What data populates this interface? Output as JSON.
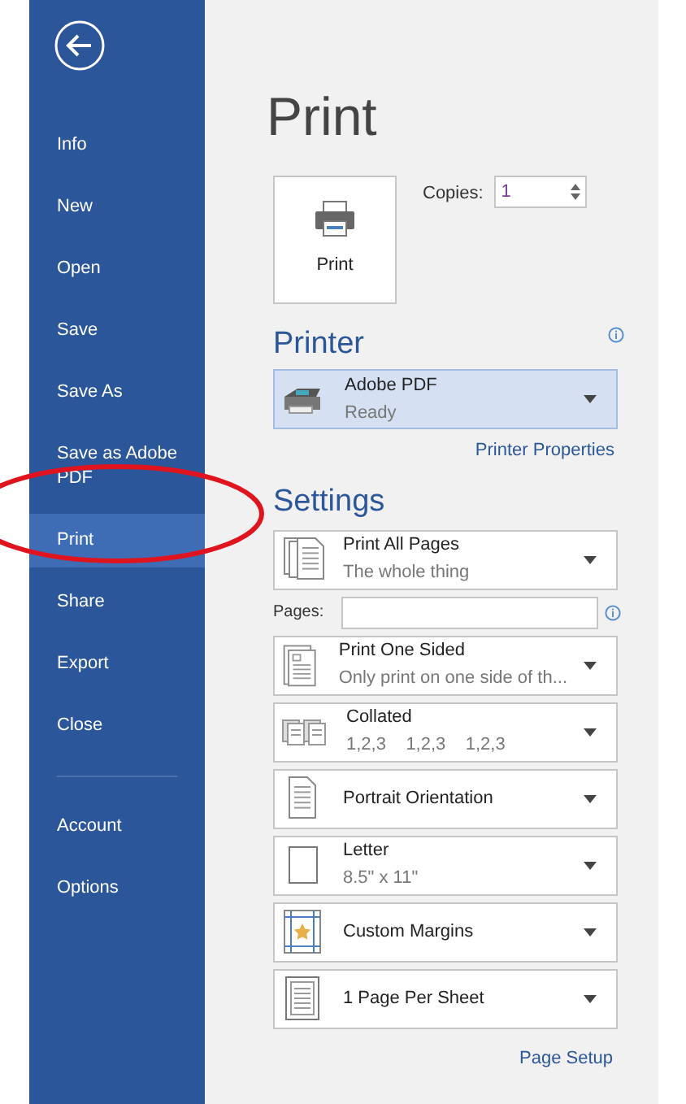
{
  "sidebar": {
    "items": [
      {
        "label": "Info",
        "selected": false
      },
      {
        "label": "New",
        "selected": false
      },
      {
        "label": "Open",
        "selected": false
      },
      {
        "label": "Save",
        "selected": false
      },
      {
        "label": "Save As",
        "selected": false
      },
      {
        "label": "Save as Adobe PDF",
        "selected": false
      },
      {
        "label": "Print",
        "selected": true
      },
      {
        "label": "Share",
        "selected": false
      },
      {
        "label": "Export",
        "selected": false
      },
      {
        "label": "Close",
        "selected": false
      }
    ],
    "footer_items": [
      {
        "label": "Account",
        "selected": false
      },
      {
        "label": "Options",
        "selected": false
      }
    ]
  },
  "title": "Print",
  "print_button": "Print",
  "copies": {
    "label": "Copies:",
    "value": "1"
  },
  "printer": {
    "heading": "Printer",
    "name": "Adobe PDF",
    "status": "Ready",
    "link": "Printer Properties"
  },
  "settings": {
    "heading": "Settings",
    "items": [
      {
        "kind": "pages",
        "title": "Print All Pages",
        "subtitle": "The whole thing"
      },
      {
        "kind": "sides",
        "title": "Print One Sided",
        "subtitle": "Only print on one side of th..."
      },
      {
        "kind": "collate",
        "title": "Collated",
        "subtitle": "1,2,3    1,2,3    1,2,3"
      },
      {
        "kind": "orientation",
        "title": "Portrait Orientation"
      },
      {
        "kind": "paper",
        "title": "Letter",
        "subtitle": "8.5\" x 11\""
      },
      {
        "kind": "margins",
        "title": "Custom Margins"
      },
      {
        "kind": "per-sheet",
        "title": "1 Page Per Sheet"
      }
    ],
    "pages_label": "Pages:",
    "link": "Page Setup"
  }
}
